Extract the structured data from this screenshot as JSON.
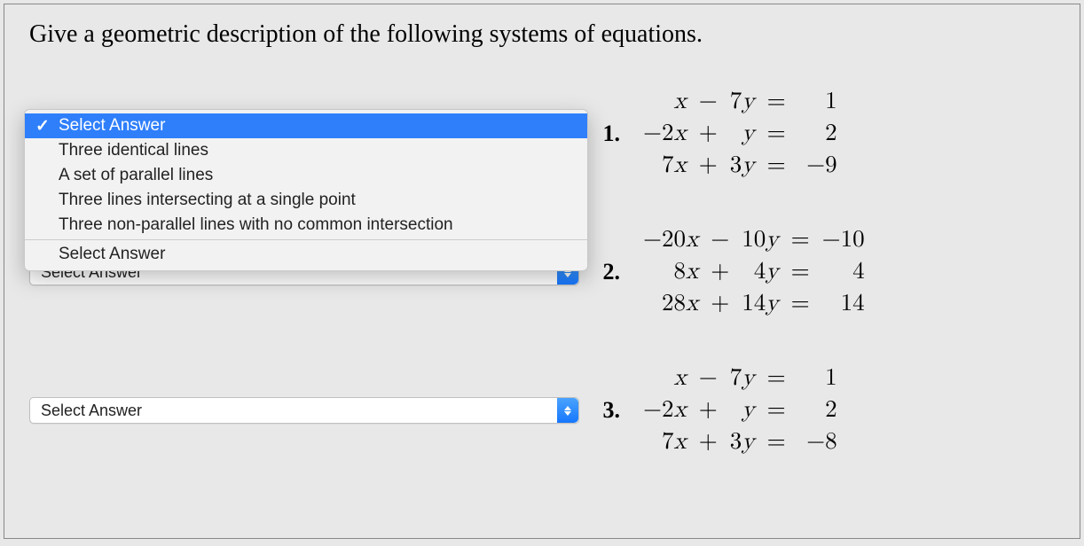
{
  "prompt": "Give a geometric description of the following systems of equations.",
  "dropdown": {
    "placeholder": "Select Answer",
    "options": [
      "Three identical lines",
      "A set of parallel lines",
      "Three lines intersecting at a single point",
      "Three non-parallel lines with no common intersection"
    ],
    "below_label": "Select Answer"
  },
  "questions": [
    {
      "num": "1.",
      "selector_label": "Select Answer",
      "eq": [
        [
          "",
          "x",
          "−",
          "7",
          "y",
          "=",
          "1"
        ],
        [
          "−2",
          "x",
          "+",
          "",
          "y",
          "=",
          "2"
        ],
        [
          "7",
          "x",
          "+",
          "3",
          "y",
          "=",
          "−9"
        ]
      ]
    },
    {
      "num": "2.",
      "selector_label": "Select Answer",
      "eq": [
        [
          "−20",
          "x",
          "−",
          "10",
          "y",
          "=",
          "−10"
        ],
        [
          "8",
          "x",
          "+",
          "4",
          "y",
          "=",
          "4"
        ],
        [
          "28",
          "x",
          "+",
          "14",
          "y",
          "=",
          "14"
        ]
      ]
    },
    {
      "num": "3.",
      "selector_label": "Select Answer",
      "eq": [
        [
          "",
          "x",
          "−",
          "7",
          "y",
          "=",
          "1"
        ],
        [
          "−2",
          "x",
          "+",
          "",
          "y",
          "=",
          "2"
        ],
        [
          "7",
          "x",
          "+",
          "3",
          "y",
          "=",
          "−8"
        ]
      ]
    }
  ]
}
